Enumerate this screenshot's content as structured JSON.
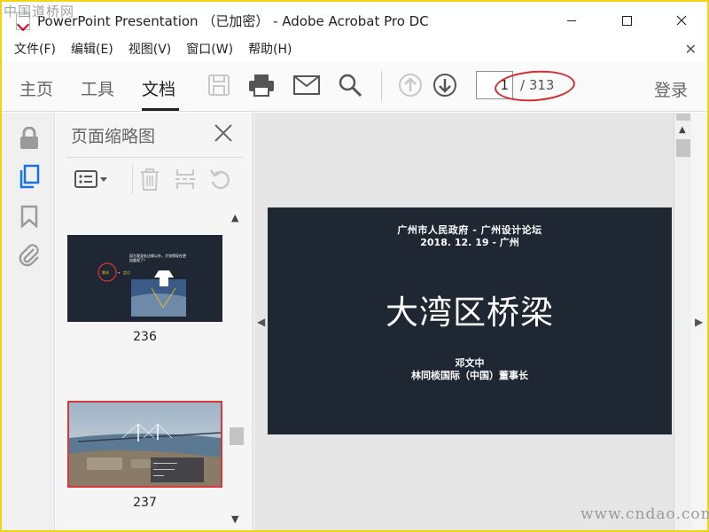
{
  "watermark": {
    "top": "中国道桥网",
    "bottom": "www.cndao.com"
  },
  "window": {
    "title": "PowerPoint Presentation （已加密） - Adobe Acrobat Pro DC"
  },
  "menu": [
    "文件(F)",
    "编辑(E)",
    "视图(V)",
    "窗口(W)",
    "帮助(H)"
  ],
  "toolbar": {
    "tabs": [
      "主页",
      "工具",
      "文档"
    ],
    "active_tab": "文档",
    "page_current": "1",
    "page_total": "/ 313",
    "login": "登录",
    "icons": [
      "save-icon",
      "print-icon",
      "email-icon",
      "search-icon",
      "page-up-icon",
      "page-down-icon"
    ]
  },
  "rail_icons": [
    "lock-icon",
    "pages-icon",
    "bookmark-icon",
    "attachment-icon"
  ],
  "thumbnails_panel": {
    "title": "页面缩略图",
    "thumbnails": [
      {
        "page": "236",
        "text": "因为我身处边缘以外，才觉得现在更加重视了！",
        "tags": [
          "需求",
          "定位"
        ]
      },
      {
        "page": "237",
        "text": ""
      }
    ]
  },
  "slide": {
    "org": "广州市人民政府 - 广州设计论坛",
    "date": "2018. 12. 19 - 广州",
    "title": "大湾区桥梁",
    "author": "邓文中",
    "role": "林同棪国际（中国）董事长"
  },
  "colors": {
    "slide_bg": "#1f2733",
    "highlight": "#d12e2e",
    "frame": "#f2d511"
  }
}
